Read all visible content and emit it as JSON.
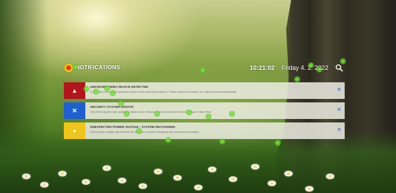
{
  "colors": {
    "error_accent": "#b4141e",
    "info_accent": "#1f5fd2",
    "warning_accent": "#f0c418",
    "close_x": "#2f5fd0",
    "gaze_dot": "#7ee04a"
  },
  "header": {
    "logo_icon": "app-logo-icon",
    "title": "NOTIFICATIONS",
    "time": "10:21:02",
    "date": "Friday 4. 2. 2022",
    "search_icon": "search-icon"
  },
  "notifications": [
    {
      "icon": "warning-triangle-icon",
      "icon_glyph": "▲",
      "title": "UNKNOWN VIDEO DEVICE DETECTED",
      "message": "A new video device was connected. Allow it to be used by this system? Please confirm the request, or it will be blocked automatically.",
      "close_glyph": "✕"
    },
    {
      "icon": "close-x-icon",
      "icon_glyph": "✕",
      "title": "SECURITY SYSTEM UPDATE",
      "message": "Your Norton system was updated to latest version. Please restart your device for all the changes to take effect.",
      "close_glyph": "✕"
    },
    {
      "icon": "info-circle-icon",
      "icon_glyph": "●",
      "title": "UNEXPECTED POWER OUTAGE - SYSTEM RECOVERED",
      "message": "A short power outage was detected. No data loss occurred. Everything was recovered successfully.",
      "close_glyph": "✕"
    }
  ]
}
